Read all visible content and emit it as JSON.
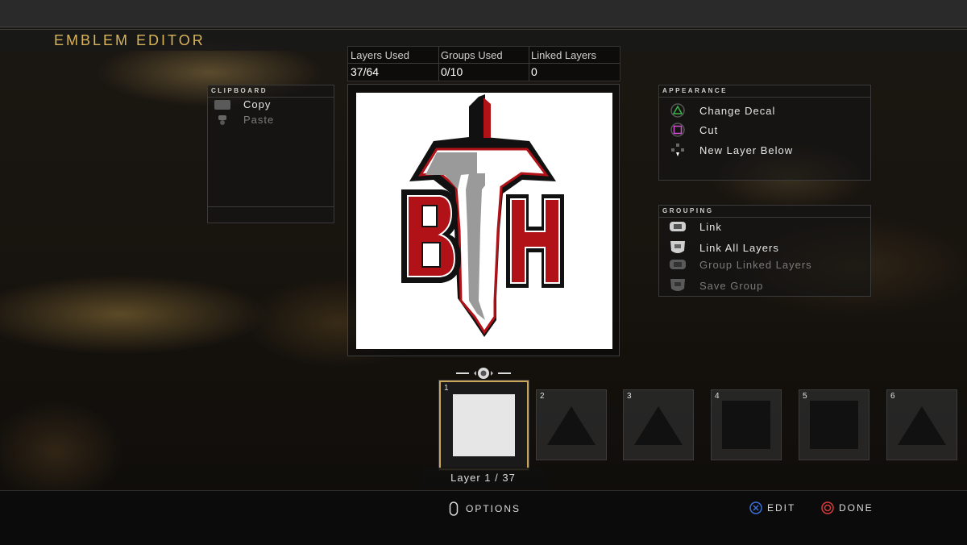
{
  "header": {
    "title": "EMBLEM EDITOR"
  },
  "stats": [
    {
      "label": "Layers Used",
      "value": "37/64"
    },
    {
      "label": "Groups Used",
      "value": "0/10"
    },
    {
      "label": "Linked Layers",
      "value": "0"
    }
  ],
  "clipboard": {
    "title": "CLIPBOARD",
    "items": [
      {
        "label": "Copy",
        "icon": "touchpad-icon",
        "enabled": true
      },
      {
        "label": "Paste",
        "icon": "touchpad-press-icon",
        "enabled": false
      }
    ]
  },
  "appearance": {
    "title": "APPEARANCE",
    "items": [
      {
        "label": "Change Decal",
        "icon": "triangle-button-icon",
        "color": "#39b54a"
      },
      {
        "label": "Cut",
        "icon": "square-button-icon",
        "color": "#d04fd0"
      },
      {
        "label": "New Layer Below",
        "icon": "dpad-down-icon",
        "color": "#ffffff"
      }
    ]
  },
  "grouping": {
    "title": "GROUPING",
    "items": [
      {
        "label": "Link",
        "icon": "l1-icon",
        "enabled": true
      },
      {
        "label": "Link All Layers",
        "icon": "l2-icon",
        "enabled": true
      },
      {
        "label": "Group Linked Layers",
        "icon": "r1-icon",
        "enabled": false
      },
      {
        "label": "Save Group",
        "icon": "r2-icon",
        "enabled": false
      }
    ]
  },
  "emblem": {
    "letters": [
      "B",
      "H"
    ],
    "colors": {
      "red": "#b01218",
      "gray": "#9a9a9a",
      "black": "#111111"
    }
  },
  "layers": {
    "nav_icon": "r3-stick-icon",
    "slots": [
      {
        "number": "1",
        "shape": "square",
        "color": "#e6e6e6",
        "selected": true
      },
      {
        "number": "2",
        "shape": "triangle",
        "color": "#111111",
        "selected": false
      },
      {
        "number": "3",
        "shape": "triangle",
        "color": "#111111",
        "selected": false
      },
      {
        "number": "4",
        "shape": "square",
        "color": "#111111",
        "selected": false
      },
      {
        "number": "5",
        "shape": "square",
        "color": "#111111",
        "selected": false
      },
      {
        "number": "6",
        "shape": "triangle",
        "color": "#111111",
        "selected": false
      }
    ],
    "current_label": "Layer 1 / 37"
  },
  "footer": {
    "options": {
      "label": "OPTIONS",
      "icon": "options-button-icon"
    },
    "edit": {
      "label": "EDIT",
      "icon": "cross-button-icon",
      "color": "#3b6fd8"
    },
    "done": {
      "label": "DONE",
      "icon": "circle-button-icon",
      "color": "#d83b3b"
    }
  },
  "accent_color": "#d8b35a"
}
